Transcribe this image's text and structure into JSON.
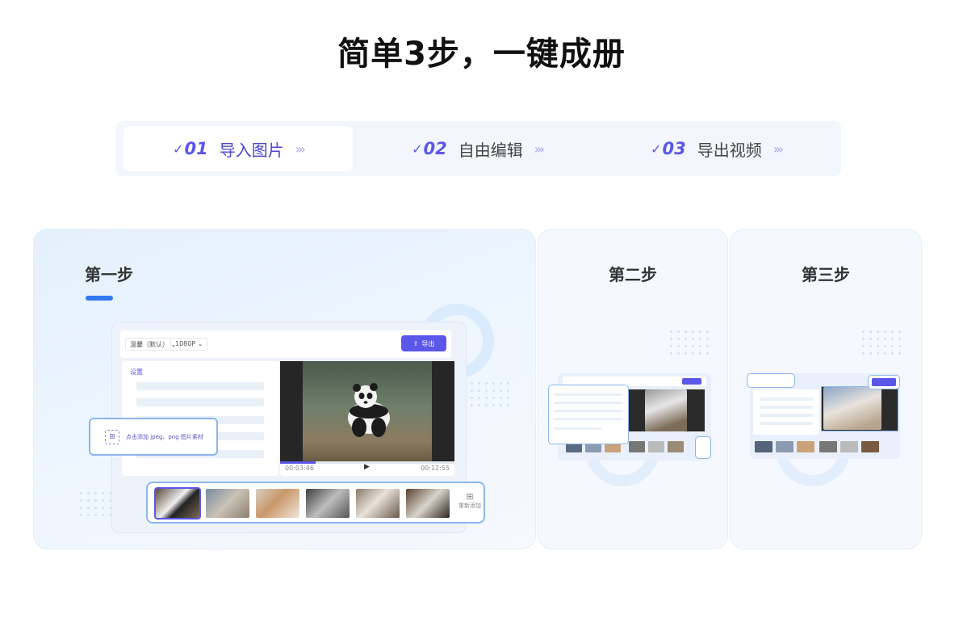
{
  "page": {
    "title": "简单3步，一键成册"
  },
  "steps": [
    {
      "num": "01",
      "label": "导入图片",
      "active": true
    },
    {
      "num": "02",
      "label": "自由编辑",
      "active": false
    },
    {
      "num": "03",
      "label": "导出视频",
      "active": false
    }
  ],
  "cards": [
    {
      "title": "第一步"
    },
    {
      "title": "第二步"
    },
    {
      "title": "第三步"
    }
  ],
  "mock": {
    "template_select": "温馨（默认）",
    "resolution_select": "1080P",
    "export_label": "导出",
    "settings_label": "设置",
    "time_current": "00:03:46",
    "time_total": "00:12:55",
    "upload_hint": "点击添加 jpeg、png 图片素材",
    "readd_label": "重新添加"
  },
  "colors": {
    "accent": "#5b57e8",
    "highlight_border": "#8bb6ec",
    "step_bar_bg": "#f3f7fd",
    "underline": "#3477f0"
  },
  "icons": {
    "step_prefix": "checkmark-icon",
    "step_arrow": "triple-chevron-right-icon",
    "export": "upload-icon",
    "play": "play-icon",
    "image_add": "image-add-icon"
  }
}
